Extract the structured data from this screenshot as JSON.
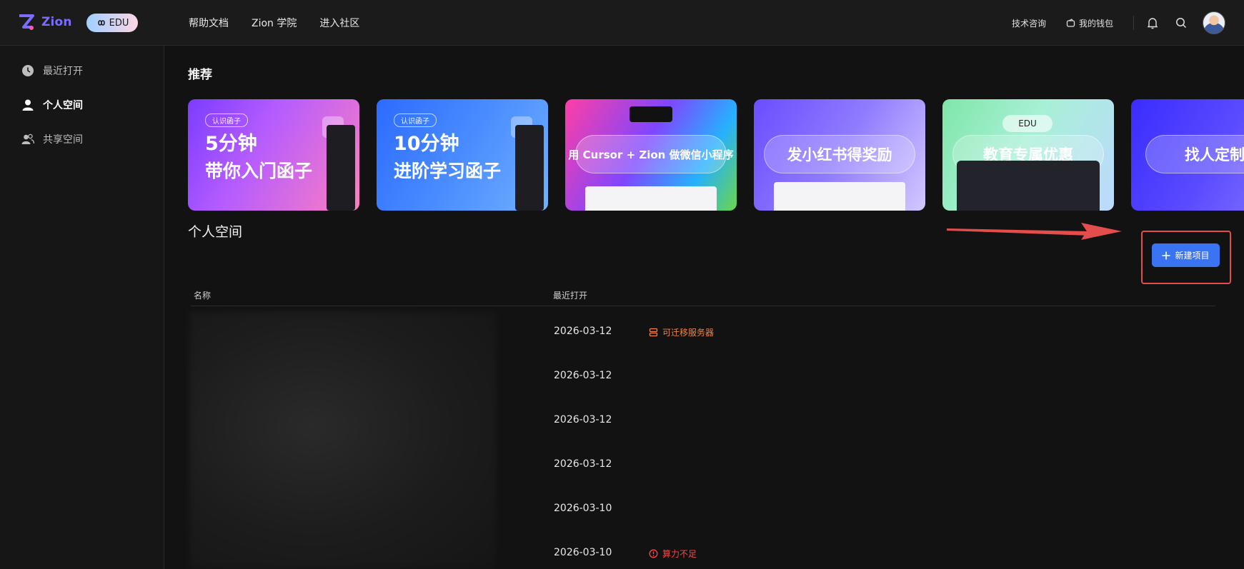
{
  "brand": {
    "name": "Zion",
    "edu_label": "EDU"
  },
  "topnav": {
    "items": [
      "帮助文档",
      "Zion 学院",
      "进入社区"
    ]
  },
  "topright": {
    "consult": "技术咨询",
    "wallet": "我的钱包"
  },
  "sidebar": {
    "items": [
      {
        "label": "最近打开",
        "icon": "clock-icon"
      },
      {
        "label": "个人空间",
        "icon": "user-icon",
        "active": true
      },
      {
        "label": "共享空间",
        "icon": "users-icon"
      }
    ]
  },
  "recommend": {
    "title": "推荐",
    "banners": [
      {
        "tag": "认识函子",
        "line1": "5分钟",
        "line2": "带你入门函子"
      },
      {
        "tag": "认识函子",
        "line1": "10分钟",
        "line2": "进阶学习函子"
      },
      {
        "caption": "用 Cursor + Zion 做微信小程序"
      },
      {
        "caption": "发小红书得奖励"
      },
      {
        "caption": "教育专属优惠",
        "badge": "EDU"
      },
      {
        "caption": "找人定制"
      }
    ]
  },
  "space": {
    "title": "个人空间",
    "new_button": "新建项目",
    "columns": {
      "name": "名称",
      "last_opened": "最近打开"
    },
    "rows": [
      {
        "date": "2026-03-12",
        "status": "可迁移服务器",
        "status_type": "migrate"
      },
      {
        "date": "2026-03-12",
        "status": ""
      },
      {
        "date": "2026-03-12",
        "status": ""
      },
      {
        "date": "2026-03-12",
        "status": ""
      },
      {
        "date": "2026-03-10",
        "status": ""
      },
      {
        "date": "2026-03-10",
        "status": "算力不足",
        "status_type": "low"
      }
    ]
  },
  "colors": {
    "accent": "#3b74f2",
    "highlight": "#e54d4d",
    "migrate": "#f5813b",
    "low": "#ef4a4a"
  }
}
